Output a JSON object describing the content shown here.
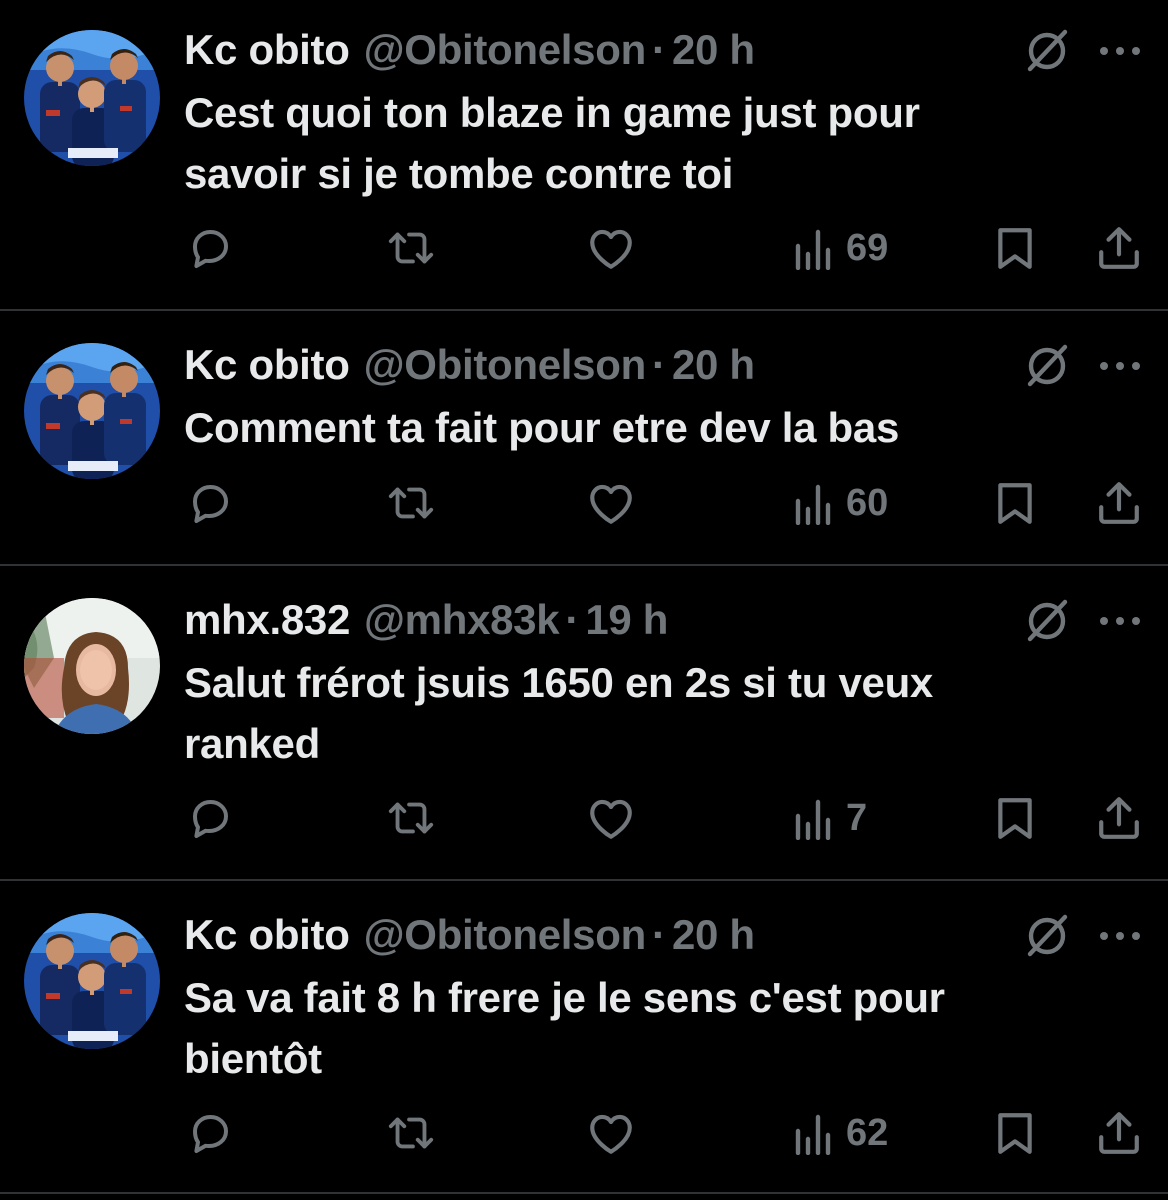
{
  "colors": {
    "background": "#000000",
    "text_primary": "#e7e9ea",
    "text_secondary": "#71767b",
    "divider": "#2f3336"
  },
  "icons": {
    "reply": "speech-bubble",
    "retweet": "two-arrows-loop",
    "like": "heart-outline",
    "views": "bar-chart",
    "bookmark": "bookmark-outline",
    "share": "upload-arrow",
    "grok": "slashed-circle",
    "more": "three-dots"
  },
  "tweets": [
    {
      "display_name": "Kc obito",
      "handle": "@Obitonelson",
      "separator": "·",
      "time": "20 h",
      "lines": [
        "Cest quoi ton blaze in game just pour",
        "savoir si je tombe contre toi"
      ],
      "views": "69"
    },
    {
      "display_name": "Kc obito",
      "handle": "@Obitonelson",
      "separator": "·",
      "time": "20 h",
      "lines": [
        "Comment ta fait pour etre dev la bas"
      ],
      "views": "60"
    },
    {
      "display_name": "mhx.832",
      "handle": "@mhx83k",
      "separator": "·",
      "time": "19 h",
      "lines": [
        "Salut frérot jsuis 1650 en 2s si tu veux",
        "ranked"
      ],
      "views": "7"
    },
    {
      "display_name": "Kc obito",
      "handle": "@Obitonelson",
      "separator": "·",
      "time": "20 h",
      "lines": [
        "Sa va fait 8 h frere je le sens c'est pour",
        "bientôt"
      ],
      "views": "62"
    }
  ]
}
